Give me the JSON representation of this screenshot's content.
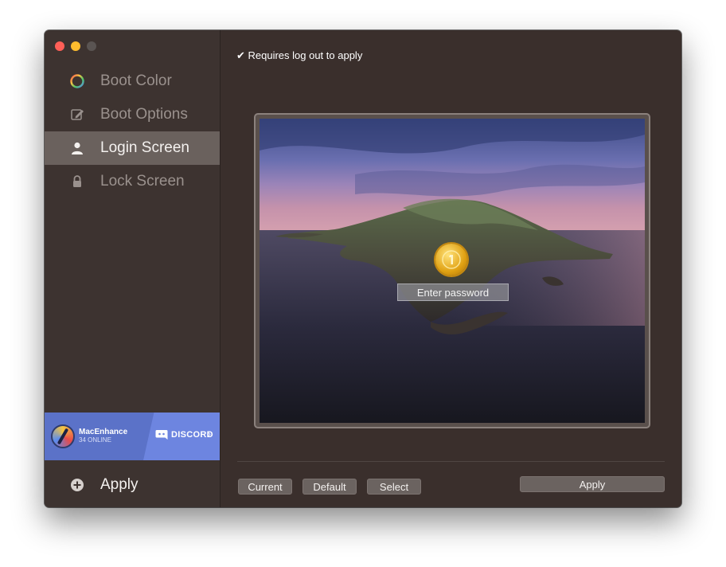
{
  "sidebar": {
    "items": [
      {
        "label": "Boot Color",
        "icon": "color-wheel-icon",
        "active": false
      },
      {
        "label": "Boot Options",
        "icon": "edit-icon",
        "active": false
      },
      {
        "label": "Login Screen",
        "icon": "user-icon",
        "active": true
      },
      {
        "label": "Lock Screen",
        "icon": "lock-icon",
        "active": false
      }
    ],
    "banner": {
      "app_name": "MacEnhance",
      "online": "34 ONLINE",
      "service": "DISCORD",
      "colors": {
        "left": "#5b72c8",
        "right": "#6d85e0"
      }
    },
    "apply_label": "Apply",
    "apply_icon": "plus-circle-icon"
  },
  "main": {
    "note": "✔ Requires log out to apply",
    "password_placeholder": "Enter password",
    "avatar_icon": "gold-coin-icon",
    "buttons": {
      "current": "Current",
      "default": "Default",
      "select": "Select",
      "apply": "Apply"
    }
  },
  "colors": {
    "window_bg": "#3a2f2c",
    "sidebar_active": "#6a615d",
    "text_inactive": "#9a918d"
  }
}
